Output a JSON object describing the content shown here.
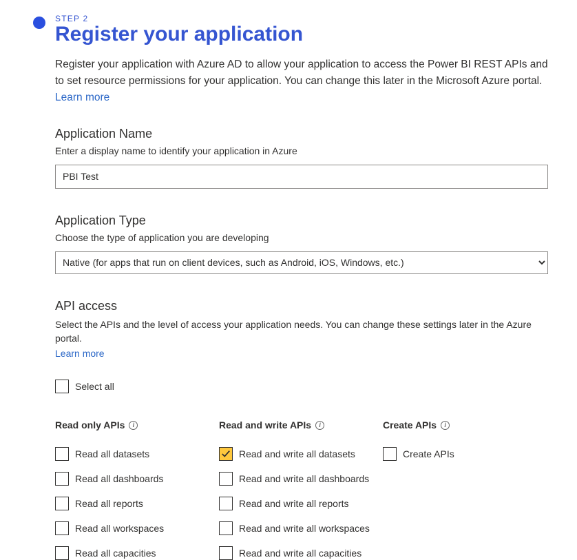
{
  "step": {
    "label": "STEP 2",
    "title": "Register your application",
    "description": "Register your application with Azure AD to allow your application to access the Power BI REST APIs and to set resource permissions for your application. You can change this later in the Microsoft Azure portal.",
    "learn_more": "Learn more"
  },
  "appName": {
    "label": "Application Name",
    "hint": "Enter a display name to identify your application in Azure",
    "value": "PBI Test"
  },
  "appType": {
    "label": "Application Type",
    "hint": "Choose the type of application you are developing",
    "selected": "Native (for apps that run on client devices, such as Android, iOS, Windows, etc.)"
  },
  "apiAccess": {
    "label": "API access",
    "hint": "Select the APIs and the level of access your application needs. You can change these settings later in the Azure portal.",
    "learn_more": "Learn more",
    "select_all": "Select all"
  },
  "columns": {
    "read_only": "Read only APIs",
    "read_write": "Read and write APIs",
    "create": "Create APIs"
  },
  "readOnly": [
    "Read all datasets",
    "Read all dashboards",
    "Read all reports",
    "Read all workspaces",
    "Read all capacities"
  ],
  "readWrite": [
    "Read and write all datasets",
    "Read and write all dashboards",
    "Read and write all reports",
    "Read and write all workspaces",
    "Read and write all capacities"
  ],
  "create": [
    "Create APIs"
  ],
  "checked": {
    "readWrite0": true
  }
}
